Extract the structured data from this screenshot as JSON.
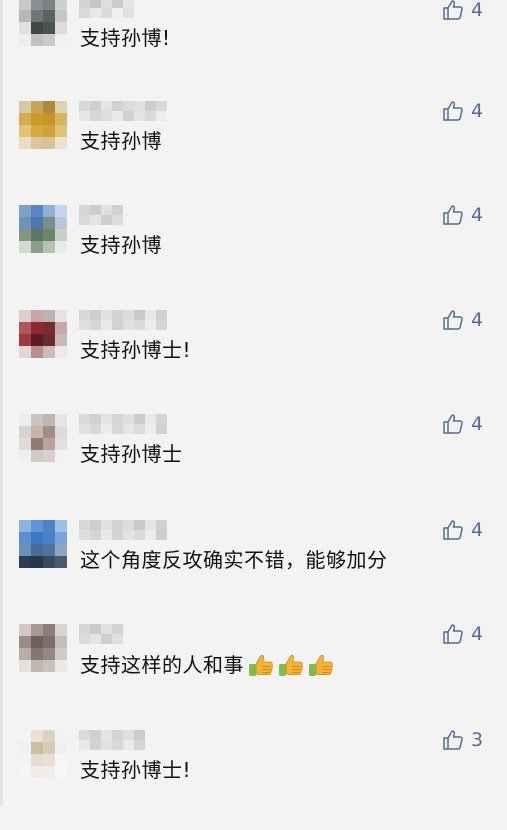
{
  "comments": [
    {
      "text": "支持孙博!",
      "likes": "4",
      "emoji_count": 0,
      "avatar": [
        "#c9c9c9",
        "#8a8f92",
        "#7d8285",
        "#cfcfcf",
        "#b4b8b7",
        "#6e7773",
        "#5a6360",
        "#c5c7c6",
        "#e0e0df",
        "#3f4745",
        "#4b5350",
        "#dcdcdc",
        "#ededed",
        "#bfc2c1",
        "#c8cac9",
        "#f1f1f1"
      ],
      "name": [
        "#d4d4d4",
        "#c6c6c6",
        "#dedede",
        "#cbcbcb",
        "#e6e6e6",
        "#d9d9d9",
        "#e8e8e8",
        "#dbdbdb",
        "#efefef",
        "#e2e2e2"
      ]
    },
    {
      "text": "支持孙博",
      "likes": "4",
      "emoji_count": 0,
      "avatar": [
        "#d8c9a6",
        "#c9a461",
        "#b08a3c",
        "#ddd2b6",
        "#d4ae4e",
        "#c99b2b",
        "#c8952a",
        "#d7b45d",
        "#e0c472",
        "#d6a93c",
        "#d1a237",
        "#dfc27a",
        "#e8dcc1",
        "#d9c69d",
        "#d7c394",
        "#ece3cf"
      ],
      "name": [
        "#d9d9d9",
        "#cfcfcf",
        "#e3e3e3",
        "#d2d2d2",
        "#dcdcdc",
        "#e1e1e1",
        "#cdcdcd",
        "#d8d8d8",
        "#e6e6e6",
        "#d5d5d5",
        "#dedede",
        "#e9e9e9",
        "#d0d0d0",
        "#e4e4e4",
        "#dadada",
        "#ededed"
      ]
    },
    {
      "text": "支持孙博",
      "likes": "4",
      "emoji_count": 0,
      "avatar": [
        "#7ea0c9",
        "#5c86bf",
        "#8fb0d6",
        "#c7d6e8",
        "#6d93b8",
        "#4f79a8",
        "#7b8f88",
        "#b9c8d6",
        "#7f9781",
        "#5e7561",
        "#6f8569",
        "#c9d0c8",
        "#d4d9d3",
        "#8c9c8b",
        "#b7c1b5",
        "#e8ebe7"
      ],
      "name": [
        "#d6d6d6",
        "#cccccc",
        "#e0e0e0",
        "#d2d2d2",
        "#dadada",
        "#e4e4e4",
        "#cfcfcf",
        "#dddddd"
      ]
    },
    {
      "text": "支持孙博士!",
      "likes": "4",
      "emoji_count": 0,
      "avatar": [
        "#dccfcf",
        "#c9a5a5",
        "#b9b3b3",
        "#e8e2e2",
        "#b1575b",
        "#8c2a30",
        "#7a2b31",
        "#c7a9a9",
        "#a13a3f",
        "#5e1c21",
        "#6b2a2e",
        "#c8b9b9",
        "#e3d7d7",
        "#b78f8f",
        "#cdbaba",
        "#efe9e9"
      ],
      "name": [
        "#d8d8d8",
        "#cecece",
        "#e2e2e2",
        "#d4d4d4",
        "#dcdcdc",
        "#cacaca",
        "#e6e6e6",
        "#d0d0d0",
        "#dedede",
        "#d6d6d6",
        "#e9e9e9",
        "#d2d2d2",
        "#e0e0e0",
        "#dadada",
        "#ececec",
        "#d5d5d5"
      ]
    },
    {
      "text": "支持孙博士",
      "likes": "4",
      "emoji_count": 0,
      "avatar": [
        "#ececec",
        "#c8c4c2",
        "#bdb6b3",
        "#e6e6e6",
        "#d8d2cf",
        "#c9b2a7",
        "#a28d86",
        "#dcdcdc",
        "#e2dcd9",
        "#8c7b76",
        "#b7a49d",
        "#e1e1e1",
        "#efefef",
        "#cfcac8",
        "#d6d1cf",
        "#f2f2f2"
      ],
      "name": [
        "#dadada",
        "#d0d0d0",
        "#e4e4e4",
        "#d5d5d5",
        "#dedede",
        "#cccccc",
        "#e8e8e8",
        "#d3d3d3",
        "#e1e1e1",
        "#d9d9d9",
        "#ebebeb",
        "#d7d7d7",
        "#e5e5e5",
        "#dcdcdc",
        "#eeeeee",
        "#d1d1d1"
      ]
    },
    {
      "text": "这个角度反攻确实不错，能够加分",
      "likes": "4",
      "emoji_count": 0,
      "avatar": [
        "#8db2dc",
        "#5f93d2",
        "#4c84c9",
        "#9fbfe2",
        "#5b8fcf",
        "#3e77c2",
        "#4a80c6",
        "#79a4d6",
        "#6c8fb8",
        "#4a6d98",
        "#52739b",
        "#8fa6c2",
        "#2e3d52",
        "#2a3749",
        "#3a4a60",
        "#4a5b70"
      ],
      "name": [
        "#d8d8d8",
        "#cdcdcd",
        "#e2e2e2",
        "#d3d3d3",
        "#dcdcdc",
        "#c9c9c9",
        "#e6e6e6",
        "#d1d1d1",
        "#dfdfdf",
        "#d6d6d6",
        "#e9e9e9",
        "#d4d4d4",
        "#e3e3e3",
        "#dadada",
        "#ececec",
        "#cfcfcf"
      ]
    },
    {
      "text": "支持这样的人和事",
      "likes": "4",
      "emoji_count": 3,
      "avatar": [
        "#cfc8c4",
        "#a69a94",
        "#8b7d77",
        "#d9d4d1",
        "#9b8d86",
        "#6e605a",
        "#7d6f69",
        "#c5bdb9",
        "#b8aca6",
        "#857770",
        "#94877f",
        "#d1cbc8",
        "#e4e0de",
        "#bfb6b1",
        "#c9c1bd",
        "#ebe8e6"
      ],
      "name": [
        "#d6d6d6",
        "#cbcbcb",
        "#e1e1e1",
        "#d2d2d2",
        "#dbdbdb",
        "#e5e5e5",
        "#cfcfcf",
        "#dedede"
      ]
    },
    {
      "text": "支持孙博士!",
      "likes": "3",
      "emoji_count": 0,
      "avatar": [
        "#f4f4f4",
        "#e9e1d2",
        "#dcd2c0",
        "#f2f2f2",
        "#f0f0f0",
        "#cdbfa4",
        "#d8ccb5",
        "#efefef",
        "#f3f3f3",
        "#e2dccf",
        "#e6e0d5",
        "#f5f5f5",
        "#f6f6f6",
        "#efece6",
        "#f1eee9",
        "#f7f7f7"
      ],
      "name": [
        "#dadada",
        "#d0d0d0",
        "#e4e4e4",
        "#d5d5d5",
        "#dedede",
        "#cdcdcd",
        "#e8e8e8",
        "#d3d3d3",
        "#e1e1e1",
        "#d8d8d8",
        "#ebebeb",
        "#d6d6d6"
      ]
    }
  ],
  "colors": {
    "background": "#f3f3f3",
    "text": "#111111",
    "like": "#576b95",
    "thumb_emoji": "#f5b335",
    "cuff": "#7cc04b"
  },
  "icons": {
    "like": "thumbs-up-outline-icon",
    "emoji": "thumbs-up-emoji-icon"
  }
}
